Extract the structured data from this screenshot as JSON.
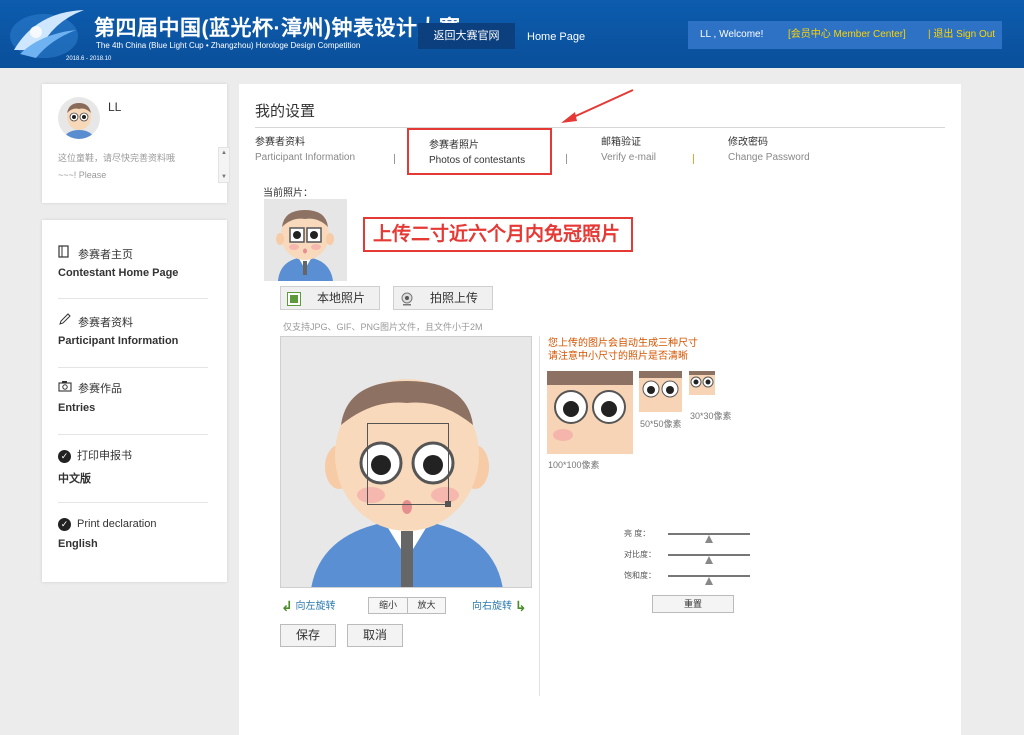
{
  "header": {
    "title_cn": "第四届中国(蓝光杯·漳州)钟表设计大赛",
    "title_en": "The 4th China (Blue Light Cup • Zhangzhou) Horologe Design Competition",
    "date_range": "2018.6 - 2018.10",
    "nav_official": "返回大赛官网",
    "nav_home": "Home Page",
    "welcome": "LL , Welcome!",
    "member_center": "[会员中心 Member Center]",
    "signout": "| 退出 Sign Out"
  },
  "profile": {
    "name": "LL",
    "note": "这位童鞋，请尽快完善资料哦~~~! Please"
  },
  "menu": [
    {
      "icon": "home-icon",
      "cn": "参赛者主页",
      "en": "Contestant Home Page"
    },
    {
      "icon": "pencil-icon",
      "cn": "参赛者资料",
      "en": "Participant Information"
    },
    {
      "icon": "camera-icon",
      "cn": "参赛作品",
      "en": "Entries"
    },
    {
      "icon": "check-icon",
      "cn": "打印申报书",
      "en": "中文版"
    },
    {
      "icon": "check-icon",
      "cn": "Print declaration",
      "en": "English"
    }
  ],
  "main": {
    "title": "我的设置",
    "tabs": [
      {
        "cn": "参赛者资料",
        "en": "Participant Information"
      },
      {
        "cn": "参赛者照片",
        "en": "Photos of contestants"
      },
      {
        "cn": "邮箱验证",
        "en": "Verify e-mail"
      },
      {
        "cn": "修改密码",
        "en": "Change Password"
      }
    ],
    "current_photo_label": "当前照片：",
    "callout": "上传二寸近六个月内免冠照片",
    "btn_local": "本地照片",
    "btn_camera": "拍照上传",
    "hint": "仅支持JPG、GIF、PNG图片文件，且文件小于2M",
    "preview_note_1": "您上传的图片会自动生成三种尺寸",
    "preview_note_2": "请注意中小尺寸的照片是否清晰",
    "preview_labels": [
      "100*100像素",
      "50*50像素",
      "30*30像素"
    ],
    "sliders": [
      {
        "label": "亮  度：",
        "value": 0.5
      },
      {
        "label": "对比度：",
        "value": 0.5
      },
      {
        "label": "饱和度：",
        "value": 0.5
      }
    ],
    "reset": "重置",
    "rotate_left": "向左旋转",
    "rotate_right": "向右旋转",
    "zoom_out": "缩小",
    "zoom_in": "放大",
    "save": "保存",
    "cancel": "取消"
  }
}
